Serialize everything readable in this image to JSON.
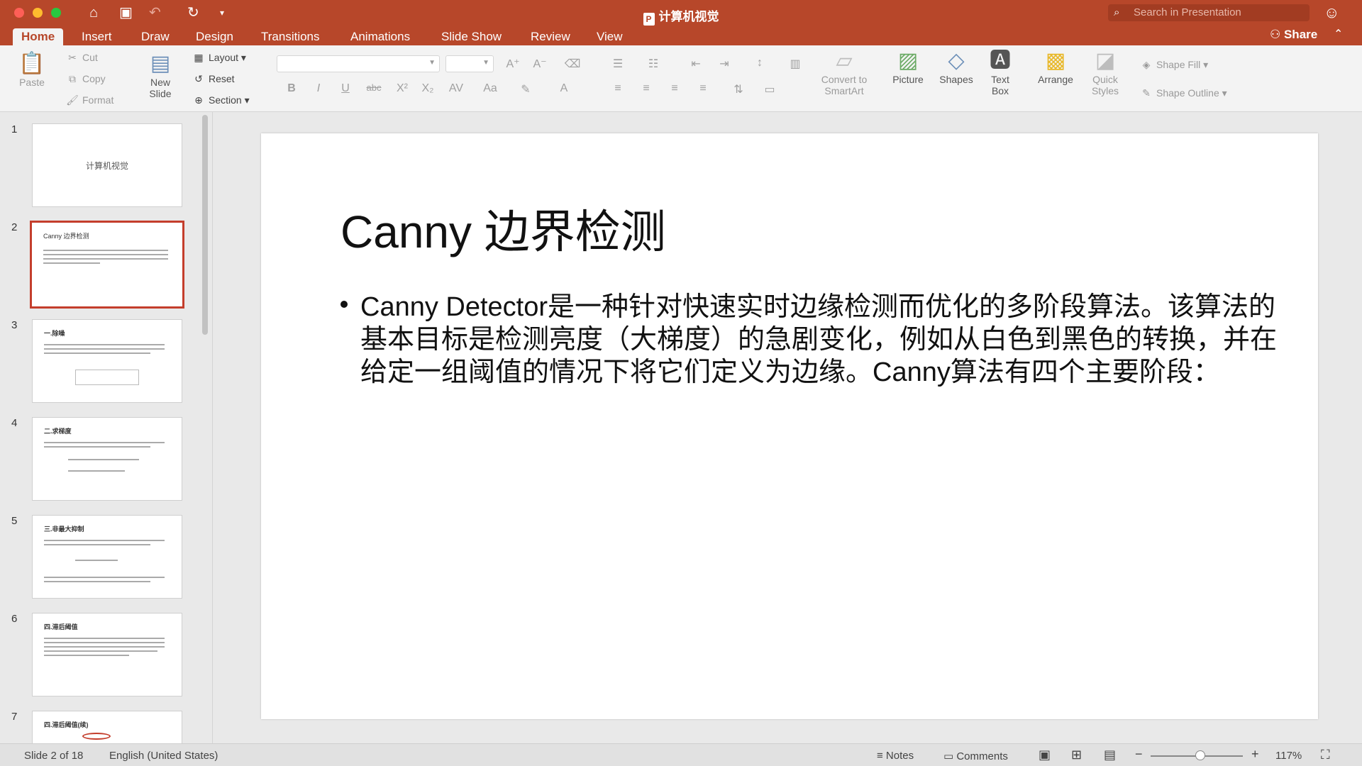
{
  "window": {
    "title": "计算机视觉",
    "search_placeholder": "Search in Presentation"
  },
  "tabs": [
    "Home",
    "Insert",
    "Draw",
    "Design",
    "Transitions",
    "Animations",
    "Slide Show",
    "Review",
    "View"
  ],
  "active_tab": "Home",
  "share_label": "Share",
  "ribbon": {
    "paste": "Paste",
    "cut": "Cut",
    "copy": "Copy",
    "format": "Format",
    "new_slide": "New\nSlide",
    "layout": "Layout",
    "reset": "Reset",
    "section": "Section",
    "convert_smartart": "Convert to\nSmartArt",
    "picture": "Picture",
    "shapes": "Shapes",
    "text_box": "Text\nBox",
    "arrange": "Arrange",
    "quick_styles": "Quick\nStyles",
    "shape_fill": "Shape Fill",
    "shape_outline": "Shape Outline"
  },
  "slides": [
    {
      "num": "1",
      "title": "计算机视觉"
    },
    {
      "num": "2",
      "title": "Canny 边界检测"
    },
    {
      "num": "3",
      "title": "一.除噪"
    },
    {
      "num": "4",
      "title": "二.求梯度"
    },
    {
      "num": "5",
      "title": "三.非最大抑制"
    },
    {
      "num": "6",
      "title": "四.滞后阈值"
    },
    {
      "num": "7",
      "title": "四.滞后阈值(续)"
    }
  ],
  "current_slide": {
    "title": "Canny 边界检测",
    "body": "Canny Detector是一种针对快速实时边缘检测而优化的多阶段算法。该算法的基本目标是检测亮度（大梯度）的急剧变化，例如从白色到黑色的转换，并在给定一组阈值的情况下将它们定义为边缘。Canny算法有四个主要阶段："
  },
  "status": {
    "slide_counter": "Slide 2 of 18",
    "language": "English (United States)",
    "notes": "Notes",
    "comments": "Comments",
    "zoom": "117%"
  },
  "colors": {
    "accent": "#b7472a",
    "selected_thumb_border": "#c43e2c"
  }
}
